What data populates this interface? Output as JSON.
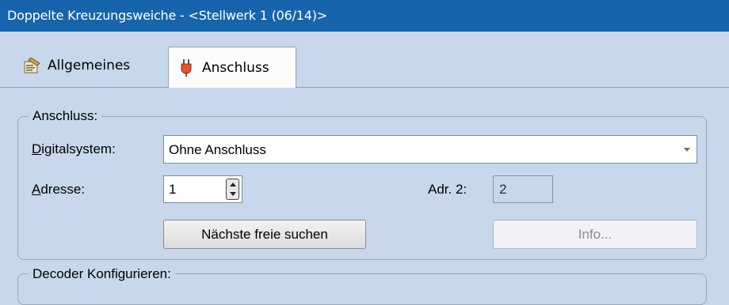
{
  "window": {
    "title": "Doppelte Kreuzungsweiche - <Stellwerk 1 (06/14)>"
  },
  "tabs": [
    {
      "label": "Allgemeines",
      "icon": "properties-icon",
      "active": false
    },
    {
      "label": "Anschluss",
      "icon": "plug-icon",
      "active": true
    }
  ],
  "anschluss_group": {
    "legend": "Anschluss:",
    "digitalsystem_label": "Digitalsystem:",
    "digitalsystem_value": "Ohne Anschluss",
    "adresse_label": "Adresse:",
    "adresse_value": "1",
    "adr2_label": "Adr. 2:",
    "adr2_value": "2",
    "next_free_button": "Nächste freie suchen",
    "info_button": "Info..."
  },
  "decoder_group": {
    "legend": "Decoder Konfigurieren:"
  },
  "colors": {
    "titlebar": "#1665ac",
    "window_bg": "#c8d7ec",
    "active_tab_bg": "#fbfcfe"
  }
}
